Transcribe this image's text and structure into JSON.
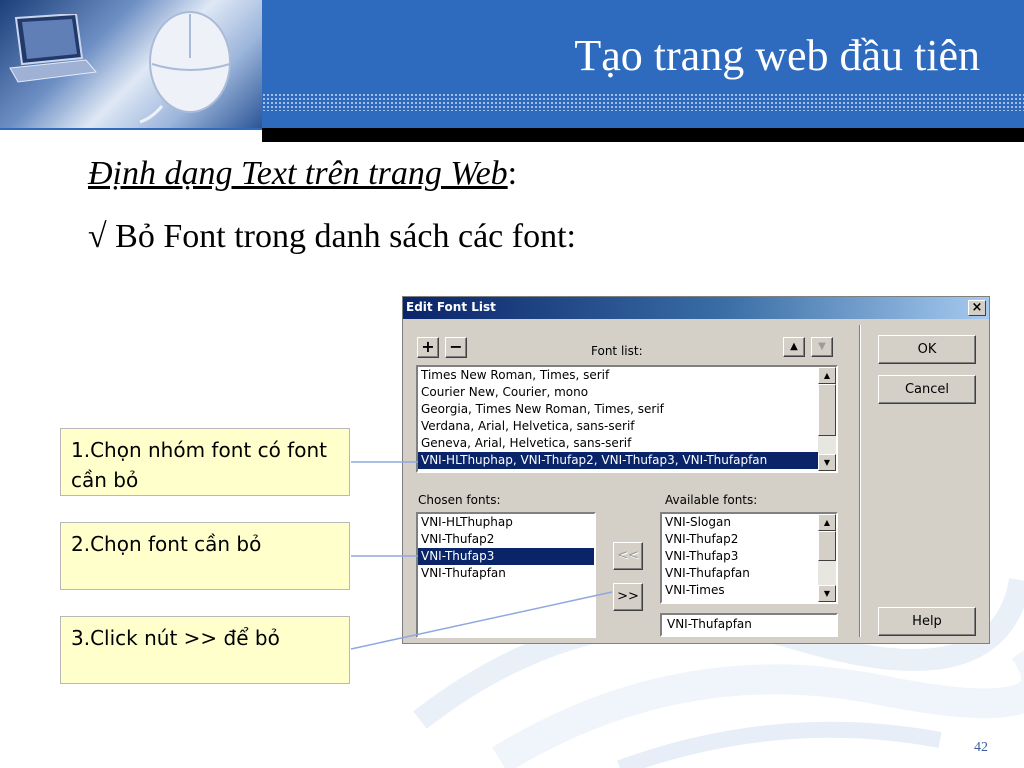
{
  "header": {
    "title": "Tạo trang web đầu tiên"
  },
  "content": {
    "subtitle": "Định dạng Text trên trang Web",
    "subtitle_suffix": ":",
    "bullet_symbol": "√",
    "bullet_text": "Bỏ Font trong danh sách các font:"
  },
  "dialog": {
    "title": "Edit Font List",
    "close_glyph": "×",
    "add_label": "+",
    "remove_label": "−",
    "up_glyph": "▲",
    "down_glyph": "▼",
    "font_list_label": "Font list:",
    "font_list": [
      "Times New Roman, Times, serif",
      "Courier New, Courier, mono",
      "Georgia, Times New Roman, Times, serif",
      "Verdana, Arial, Helvetica, sans-serif",
      "Geneva, Arial, Helvetica, sans-serif",
      "VNI-HLThuphap, VNI-Thufap2, VNI-Thufap3, VNI-Thufapfan"
    ],
    "font_list_selected": 5,
    "chosen_fonts_label": "Chosen fonts:",
    "chosen_fonts": [
      "VNI-HLThuphap",
      "VNI-Thufap2",
      "VNI-Thufap3",
      "VNI-Thufapfan"
    ],
    "chosen_fonts_selected": 2,
    "available_fonts_label": "Available fonts:",
    "available_fonts": [
      "VNI-Slogan",
      "VNI-Thufap2",
      "VNI-Thufap3",
      "VNI-Thufapfan",
      "VNI-Times"
    ],
    "available_input_value": "VNI-Thufapfan",
    "move_left_label": "<<",
    "move_right_label": ">>",
    "ok_label": "OK",
    "cancel_label": "Cancel",
    "help_label": "Help"
  },
  "callouts": {
    "step1": "1.Chọn nhóm font có font cần bỏ",
    "step2": "2.Chọn font cần bỏ",
    "step3": "3.Click nút >> để bỏ"
  },
  "page_number": "42",
  "colors": {
    "header_blue": "#2e6bbf",
    "selection": "#0a246a",
    "callout_fill": "#ffffcc",
    "connector": "#8fa8e0"
  }
}
